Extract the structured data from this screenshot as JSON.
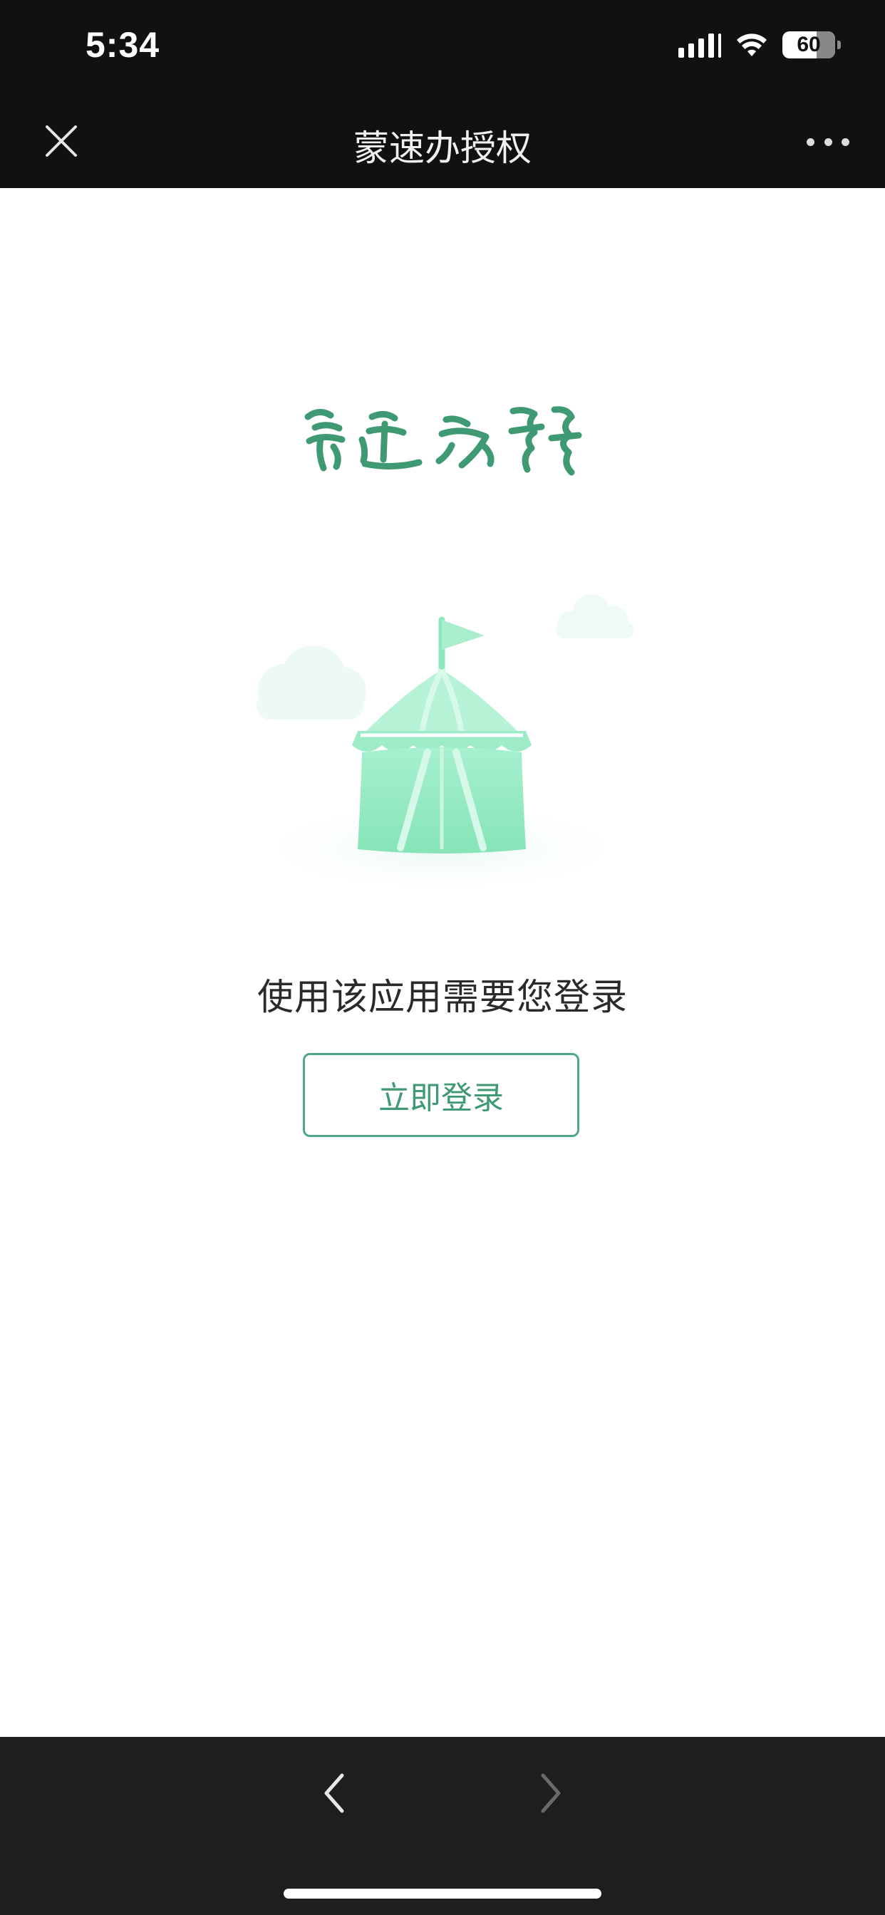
{
  "status_bar": {
    "time": "5:34",
    "battery": "60",
    "icons": [
      "signal-icon",
      "wifi-icon",
      "battery-icon"
    ]
  },
  "nav": {
    "title": "蒙速办授权",
    "close_icon": "close-icon",
    "more_icon": "more-icon"
  },
  "main": {
    "logo_icon": "mongolian-logo",
    "illustration_icon": "tent-illustration",
    "message": "使用该应用需要您登录",
    "login_button": "立即登录"
  },
  "toolbar": {
    "back_icon": "chevron-left-icon",
    "forward_icon": "chevron-right-icon"
  },
  "colors": {
    "accent": "#3f9a74",
    "bar_bg": "#111111",
    "toolbar_bg": "#1e1e1e",
    "illustration_green": "#8ae6bc"
  }
}
